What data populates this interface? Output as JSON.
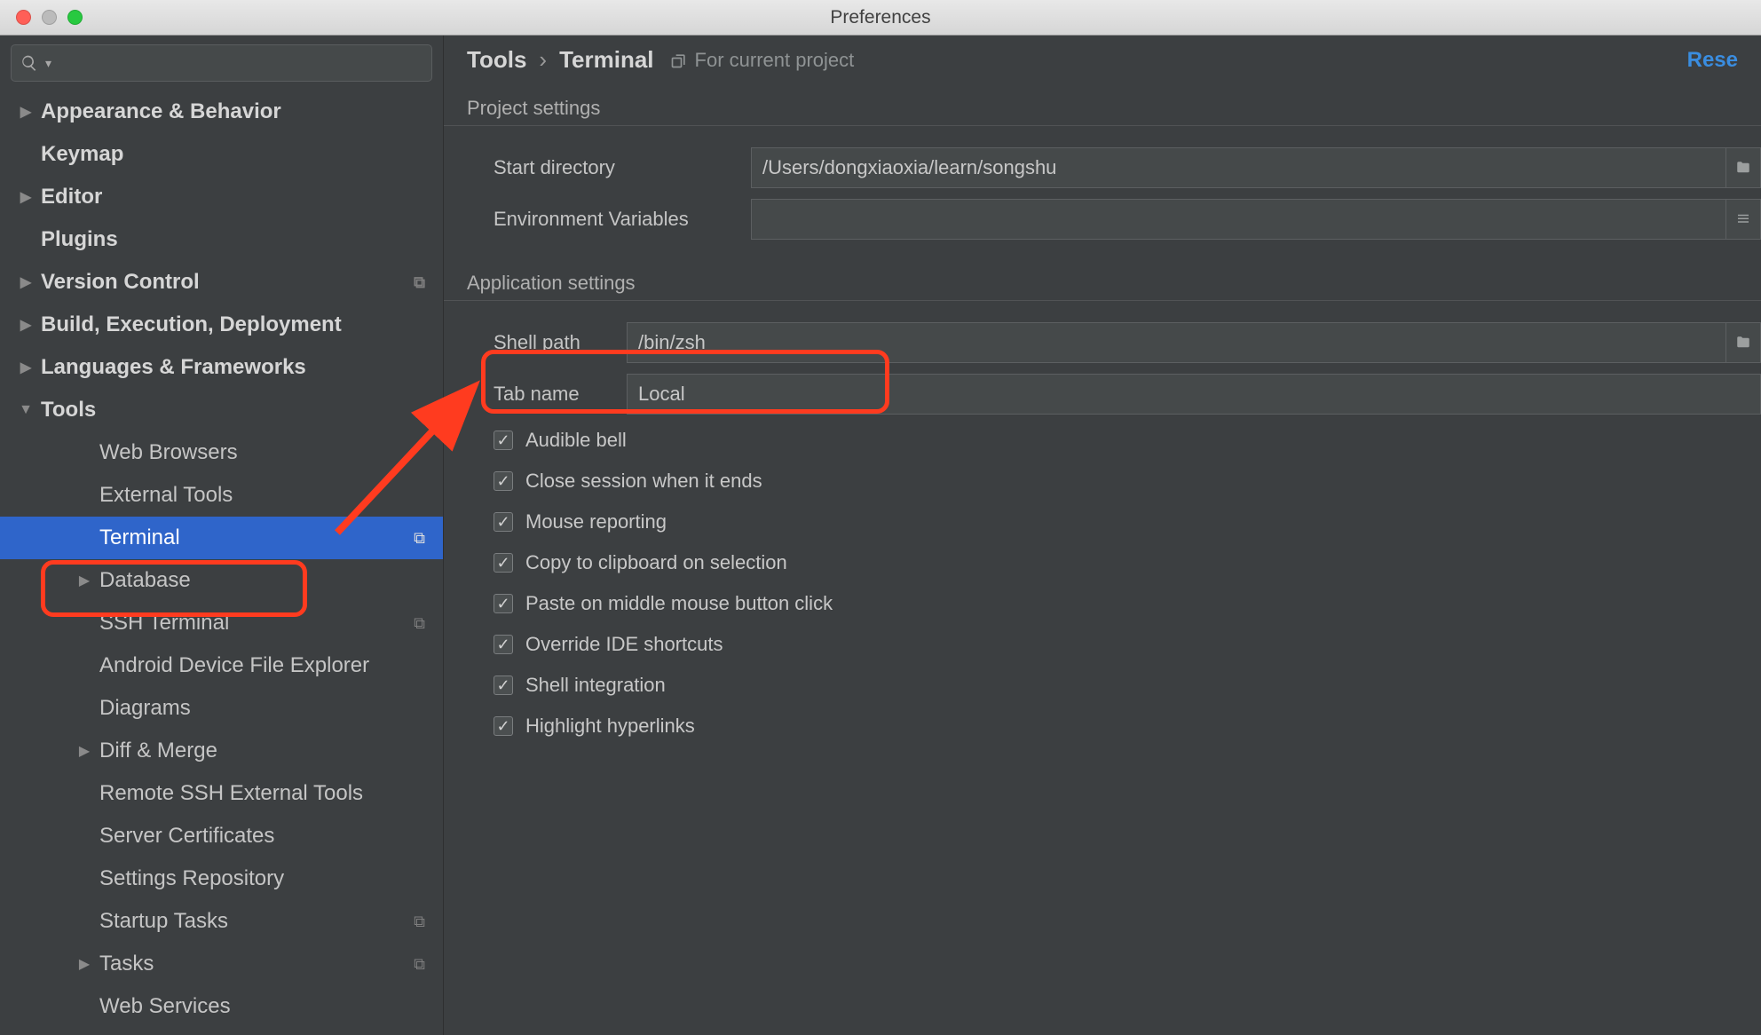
{
  "window": {
    "title": "Preferences"
  },
  "sidebar": {
    "search_placeholder": "",
    "items": [
      {
        "label": "Appearance & Behavior",
        "bold": true,
        "expandable": true,
        "level": 0
      },
      {
        "label": "Keymap",
        "bold": true,
        "expandable": false,
        "level": 0
      },
      {
        "label": "Editor",
        "bold": true,
        "expandable": true,
        "level": 0
      },
      {
        "label": "Plugins",
        "bold": true,
        "expandable": false,
        "level": 0
      },
      {
        "label": "Version Control",
        "bold": true,
        "expandable": true,
        "level": 0,
        "copy": true
      },
      {
        "label": "Build, Execution, Deployment",
        "bold": true,
        "expandable": true,
        "level": 0
      },
      {
        "label": "Languages & Frameworks",
        "bold": true,
        "expandable": true,
        "level": 0
      },
      {
        "label": "Tools",
        "bold": true,
        "expandable": true,
        "expanded": true,
        "level": 0
      },
      {
        "label": "Web Browsers",
        "level": 2
      },
      {
        "label": "External Tools",
        "level": 2
      },
      {
        "label": "Terminal",
        "level": 2,
        "selected": true,
        "copy": true
      },
      {
        "label": "Database",
        "level": 2,
        "expandable": true
      },
      {
        "label": "SSH Terminal",
        "level": 2,
        "copy": true
      },
      {
        "label": "Android Device File Explorer",
        "level": 2
      },
      {
        "label": "Diagrams",
        "level": 2
      },
      {
        "label": "Diff & Merge",
        "level": 2,
        "expandable": true
      },
      {
        "label": "Remote SSH External Tools",
        "level": 2
      },
      {
        "label": "Server Certificates",
        "level": 2
      },
      {
        "label": "Settings Repository",
        "level": 2
      },
      {
        "label": "Startup Tasks",
        "level": 2,
        "copy": true
      },
      {
        "label": "Tasks",
        "level": 2,
        "expandable": true,
        "copy": true
      },
      {
        "label": "Web Services",
        "level": 2
      }
    ]
  },
  "breadcrumb": {
    "root": "Tools",
    "leaf": "Terminal"
  },
  "for_current_project": "For current project",
  "reset_label": "Rese",
  "sections": {
    "project": {
      "title": "Project settings",
      "start_dir_label": "Start directory",
      "start_dir_value": "/Users/dongxiaoxia/learn/songshu",
      "env_label": "Environment Variables",
      "env_value": ""
    },
    "application": {
      "title": "Application settings",
      "shell_path_label": "Shell path",
      "shell_path_value": "/bin/zsh",
      "tab_name_label": "Tab name",
      "tab_name_value": "Local",
      "checks": [
        {
          "label": "Audible bell",
          "checked": true
        },
        {
          "label": "Close session when it ends",
          "checked": true
        },
        {
          "label": "Mouse reporting",
          "checked": true
        },
        {
          "label": "Copy to clipboard on selection",
          "checked": true
        },
        {
          "label": "Paste on middle mouse button click",
          "checked": true
        },
        {
          "label": "Override IDE shortcuts",
          "checked": true
        },
        {
          "label": "Shell integration",
          "checked": true
        },
        {
          "label": "Highlight hyperlinks",
          "checked": true
        }
      ]
    }
  }
}
